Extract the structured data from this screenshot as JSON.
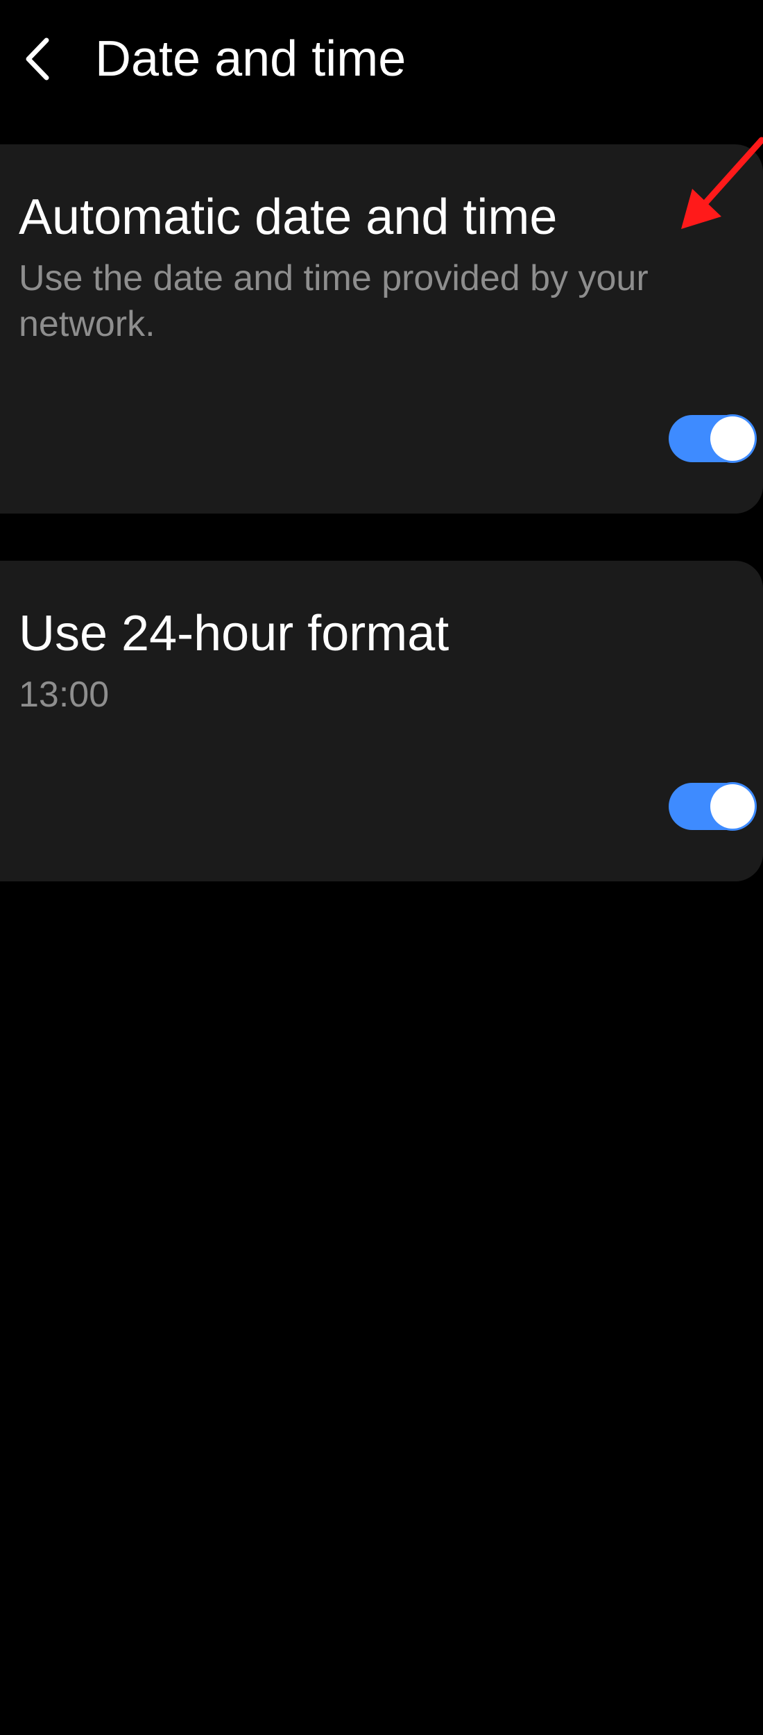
{
  "header": {
    "title": "Date and time",
    "back_icon": "chevron-left-icon"
  },
  "settings": [
    {
      "title": "Automatic date and time",
      "description": "Use the date and time provided by your network.",
      "toggle_on": true
    },
    {
      "title": "Use 24-hour format",
      "description": "13:00",
      "toggle_on": true
    }
  ],
  "colors": {
    "background": "#000000",
    "card": "#1b1b1b",
    "accent": "#3e8bff",
    "secondary_text": "#8e8e8e",
    "annotation": "#ff1a1a"
  }
}
